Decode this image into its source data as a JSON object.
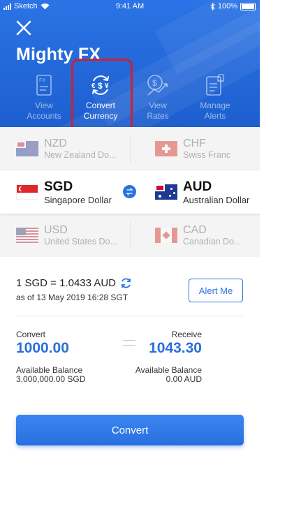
{
  "status_bar": {
    "carrier": "Sketch",
    "time": "9:41 AM",
    "battery": "100%"
  },
  "app": {
    "title": "Mighty FX"
  },
  "nav": [
    {
      "line1": "View",
      "line2": "Accounts",
      "icon": "accounts-doc-icon"
    },
    {
      "line1": "Convert",
      "line2": "Currency",
      "icon": "convert-currency-icon"
    },
    {
      "line1": "View",
      "line2": "Rates",
      "icon": "rates-chart-icon"
    },
    {
      "line1": "Manage",
      "line2": "Alerts",
      "icon": "alerts-doc-icon"
    }
  ],
  "currency_rows": {
    "top": {
      "left": {
        "code": "NZD",
        "name": "New Zealand Do..."
      },
      "right": {
        "code": "CHF",
        "name": "Swiss Franc"
      }
    },
    "main": {
      "left": {
        "code": "SGD",
        "name": "Singapore Dollar"
      },
      "right": {
        "code": "AUD",
        "name": "Australian Dollar"
      }
    },
    "bottom": {
      "left": {
        "code": "USD",
        "name": "United States Do..."
      },
      "right": {
        "code": "CAD",
        "name": "Canadian Do..."
      }
    }
  },
  "rate": {
    "text": "1 SGD = 1.0433 AUD",
    "as_of": "as of 13 May 2019 16:28 SGT"
  },
  "alert_button": "Alert Me",
  "convert_section": {
    "convert_label": "Convert",
    "convert_amount": "1000.00",
    "receive_label": "Receive",
    "receive_amount": "1043.30",
    "available_label_left": "Available Balance",
    "available_value_left": "3,000,000.00 SGD",
    "available_label_right": "Available Balance",
    "available_value_right": "0.00 AUD"
  },
  "convert_button": "Convert",
  "colors": {
    "primary": "#2a74e0",
    "highlight_box": "#d0202e"
  }
}
